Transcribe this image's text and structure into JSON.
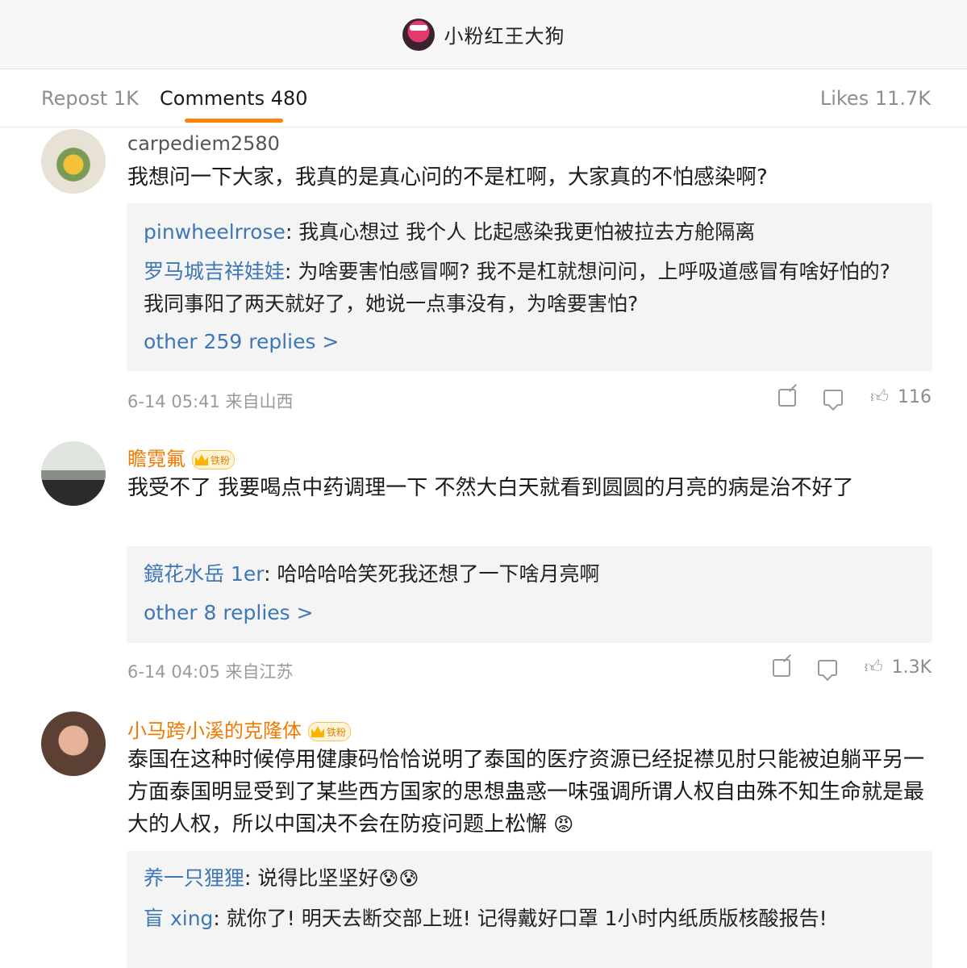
{
  "header": {
    "title": "小粉红王大狗",
    "logo_icon": "pink-dog-avatar-icon"
  },
  "tabs": {
    "repost": "Repost 1K",
    "comments": "Comments 480",
    "likes": "Likes 11.7K",
    "active_color": "#ff8200"
  },
  "comments": [
    {
      "username": "carpediem2580",
      "text": "我想问一下大家，我真的是真心问的不是杠啊，大家真的不怕感染啊?",
      "replies": [
        {
          "name": "pinwheelrrose",
          "text": ": 我真心想过 我个人 比起感染我更怕被拉去方舱隔离"
        },
        {
          "name": "罗马城吉祥娃娃",
          "text": ": 为啥要害怕感冒啊? 我不是杠就想问问，上呼吸道感冒有啥好怕的? 我同事阳了两天就好了，她说一点事没有，为啥要害怕?"
        }
      ],
      "more": "other 259 replies >",
      "meta": "6-14 05:41 来自山西",
      "likes": "116"
    },
    {
      "username": "瞻霓氟",
      "badge": "铁粉",
      "text": "我受不了 我要喝点中药调理一下 不然大白天就看到圆圆的月亮的病是治不好了",
      "replies": [
        {
          "name": "鏡花水岳 1er",
          "text": ": 哈哈哈哈笑死我还想了一下啥月亮啊"
        }
      ],
      "more": "other 8 replies >",
      "meta": "6-14 04:05 来自江苏",
      "likes": "1.3K"
    },
    {
      "username": "小马跨小溪的克隆体",
      "badge": "铁粉",
      "text": "泰国在这种时候停用健康码恰恰说明了泰国的医疗资源已经捉襟见肘只能被迫躺平另一方面泰国明显受到了某些西方国家的思想蛊惑一味强调所谓人权自由殊不知生命就是最大的人权，所以中国决不会在防疫问题上松懈",
      "text_emoji": "😡",
      "replies": [
        {
          "name": "养一只狸狸",
          "text": ": 说得比坚坚好",
          "emoji": "😰😰"
        },
        {
          "name": "盲 xing",
          "text": ": 就你了! 明天去断交部上班! 记得戴好口罩 1小时内纸质版核酸报告!"
        }
      ]
    }
  ]
}
